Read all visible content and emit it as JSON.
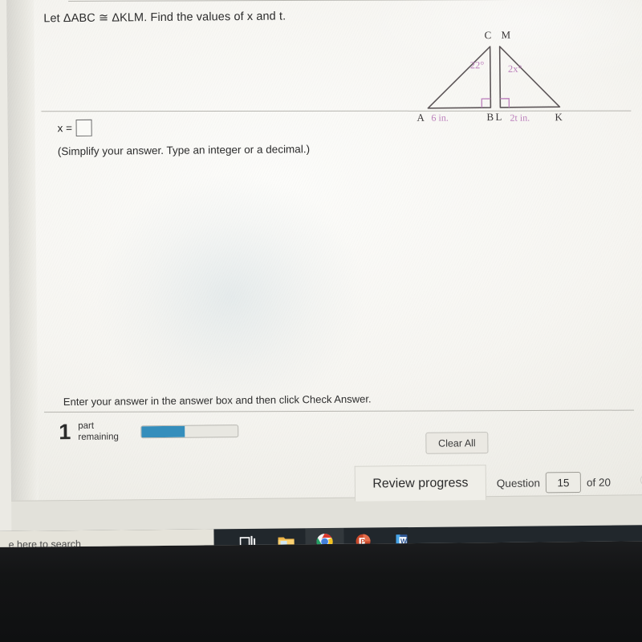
{
  "exercise": {
    "question": "Let ΔABC ≅ ΔKLM. Find the values of x and t.",
    "answer_label": "x =",
    "answer_value": "",
    "simplify_note": "(Simplify your answer. Type an integer or a decimal.)",
    "enter_note": "Enter your answer in the answer box and then click Check Answer."
  },
  "figure": {
    "triangle1": {
      "vertex_top": "C",
      "vertex_left": "A",
      "vertex_right": "B",
      "angle_label": "22°",
      "side_label": "6 in.",
      "right_angle_at": "B"
    },
    "triangle2": {
      "vertex_top": "M",
      "vertex_left": "L",
      "vertex_right": "K",
      "angle_label": "2x°",
      "side_label": "2t in.",
      "right_angle_at": "L"
    },
    "colors": {
      "outline": "#5d5558",
      "annotation": "#c07fc0"
    }
  },
  "progress": {
    "parts_remaining_count": "1",
    "parts_label_line1": "part",
    "parts_label_line2": "remaining",
    "bar_percent": 45,
    "bar_color": "#2f8fc1"
  },
  "buttons": {
    "clear_all": "Clear All",
    "review_progress": "Review progress"
  },
  "navigation": {
    "question_word": "Question",
    "question_number": "15",
    "of_text": "of 20"
  },
  "taskbar": {
    "search_placeholder": "e here to search",
    "apps": [
      {
        "name": "task-view",
        "label": "Task View",
        "active": false
      },
      {
        "name": "file-explorer",
        "label": "File Explorer",
        "active": false
      },
      {
        "name": "chrome",
        "label": "Google Chrome",
        "active": true
      },
      {
        "name": "powerpoint",
        "label": "Microsoft PowerPoint",
        "active": false
      },
      {
        "name": "word",
        "label": "Microsoft Word",
        "active": false
      }
    ]
  }
}
